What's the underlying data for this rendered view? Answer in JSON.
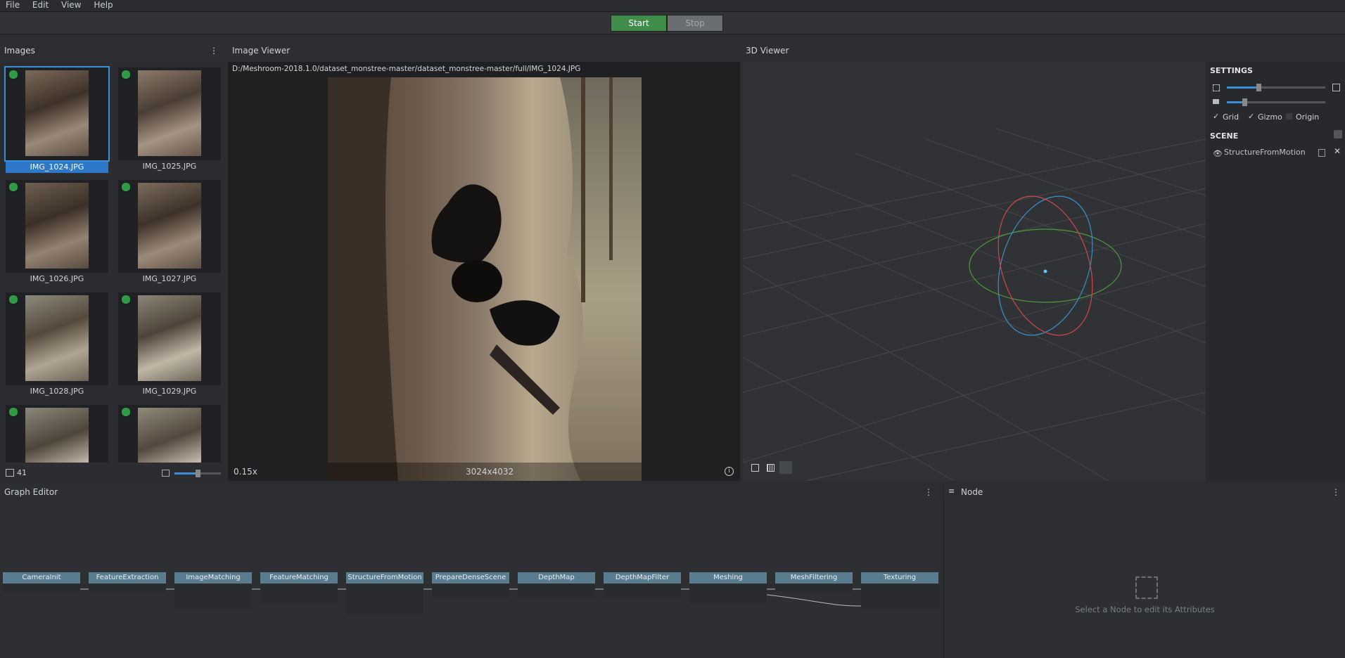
{
  "menu": [
    "File",
    "Edit",
    "View",
    "Help"
  ],
  "toolbar": {
    "start_label": "Start",
    "stop_label": "Stop"
  },
  "images": {
    "title": "Images",
    "count": "41",
    "thumbs": [
      "IMG_1024.JPG",
      "IMG_1025.JPG",
      "IMG_1026.JPG",
      "IMG_1027.JPG",
      "IMG_1028.JPG",
      "IMG_1029.JPG"
    ]
  },
  "viewer": {
    "title": "Image Viewer",
    "path": "D:/Meshroom-2018.1.0/dataset_monstree-master/dataset_monstree-master/full/IMG_1024.JPG",
    "zoom": "0.15x",
    "resolution": "3024x4032"
  },
  "viewer3d": {
    "title": "3D Viewer"
  },
  "settings": {
    "title": "SETTINGS",
    "grid_label": "Grid",
    "gizmo_label": "Gizmo",
    "origin_label": "Origin",
    "scene_title": "SCENE",
    "scene_item": "StructureFromMotion"
  },
  "graph": {
    "title": "Graph Editor",
    "nodes": [
      "CameraInit",
      "FeatureExtraction",
      "ImageMatching",
      "FeatureMatching",
      "StructureFromMotion",
      "PrepareDenseScene",
      "DepthMap",
      "DepthMapFilter",
      "Meshing",
      "MeshFiltering",
      "Texturing"
    ]
  },
  "node_panel": {
    "title": "Node",
    "placeholder": "Select a Node to edit its Attributes"
  },
  "colors": {
    "accent": "#3b8ed8",
    "start": "#3f8c4b",
    "node": "#5a7c8f",
    "gizmo_red": "#d04848",
    "gizmo_green": "#4c9a3c",
    "gizmo_blue": "#3a8fc8"
  }
}
